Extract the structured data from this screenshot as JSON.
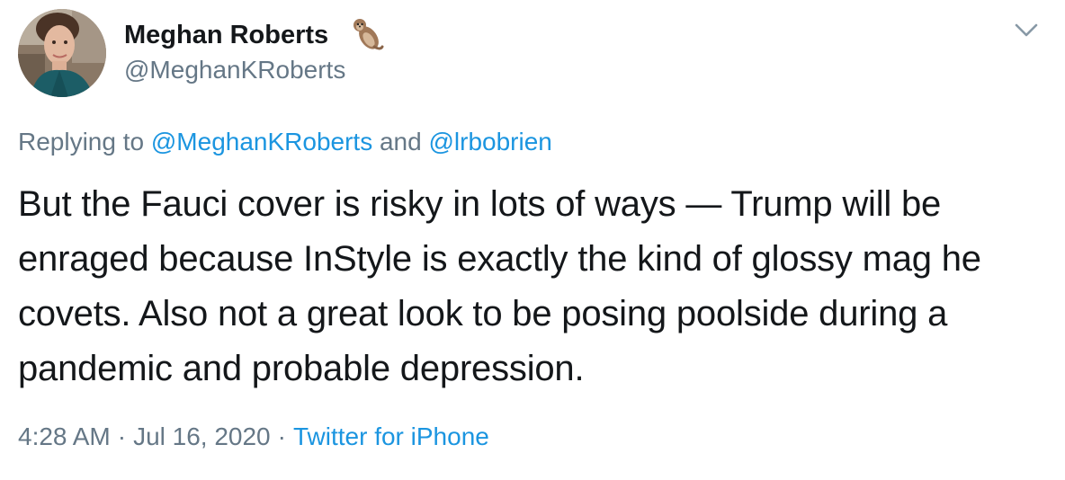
{
  "tweet": {
    "author": {
      "display_name": "Meghan Roberts",
      "handle": "@MeghanKRoberts",
      "name_emoji": "otter-icon"
    },
    "reply": {
      "prefix": "Replying to ",
      "mention_1": "@MeghanKRoberts",
      "joiner": " and ",
      "mention_2": "@lrbobrien"
    },
    "text": "But the Fauci cover is risky in lots of ways — Trump will be enraged because InStyle is exactly the kind of glossy mag he covets. Also not a great look to be posing poolside during a pandemic and probable depression.",
    "time": "4:28 AM",
    "separator": "·",
    "date": "Jul 16, 2020",
    "source": "Twitter for iPhone"
  },
  "colors": {
    "text": "#14171a",
    "secondary": "#657786",
    "link": "#1b95e0"
  }
}
